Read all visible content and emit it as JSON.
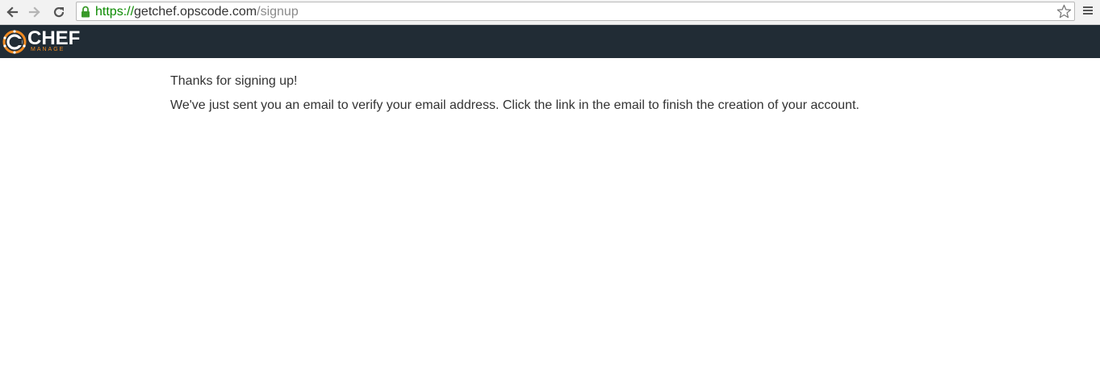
{
  "browser": {
    "url_scheme": "https://",
    "url_host": "getchef.opscode.com",
    "url_path": "/signup",
    "icons": {
      "back": "back-arrow-icon",
      "forward": "forward-arrow-icon",
      "reload": "reload-icon",
      "lock": "lock-icon",
      "star": "star-icon",
      "menu": "hamburger-menu-icon"
    }
  },
  "header": {
    "logo_word": "CHEF",
    "logo_sub": "MANAGE",
    "colors": {
      "background": "#212c35",
      "accent": "#f18b21"
    }
  },
  "main": {
    "thanks": "Thanks for signing up!",
    "message": "We've just sent you an email to verify your email address. Click the link in the email to finish the creation of your account."
  }
}
